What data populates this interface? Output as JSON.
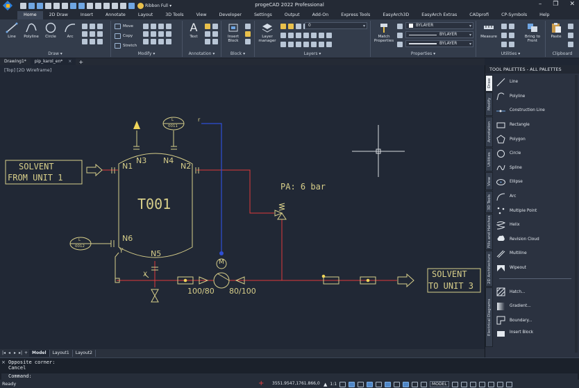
{
  "app": {
    "title": "progeCAD 2022 Professional",
    "ribbon_mode": "Ribbon Full",
    "window_controls": [
      "–",
      "❐",
      "✕"
    ]
  },
  "tabs": [
    "Home",
    "2D Draw",
    "Insert",
    "Annotate",
    "Layout",
    "3D Tools",
    "View",
    "Developer",
    "Settings",
    "Output",
    "Add-On",
    "Express Tools",
    "EasyArch3D",
    "EasyArch Extras",
    "CADprofi",
    "CP-Symbols",
    "Help"
  ],
  "ribbon": {
    "draw": {
      "title": "Draw",
      "tools": [
        "Line",
        "Polyline",
        "Circle",
        "Arc"
      ]
    },
    "modify": {
      "title": "Modify",
      "tools": [
        "Move",
        "Copy",
        "Stretch"
      ]
    },
    "annotation": {
      "title": "Annotation",
      "text": "Text"
    },
    "block": {
      "title": "Block",
      "insert": "Insert Block"
    },
    "layers": {
      "title": "Layers",
      "manager": "Layer manager",
      "current_layer": "0"
    },
    "properties": {
      "title": "Properties",
      "match": "Match Properties",
      "color": "BYLAYER",
      "linetype": "BYLAYER",
      "lineweight": "BYLAYER"
    },
    "utilities": {
      "title": "Utilities",
      "measure": "Measure",
      "bring_to_front": "Bring to Front"
    },
    "clipboard": {
      "title": "Clipboard",
      "paste": "Paste"
    }
  },
  "document_tabs": [
    "Drawing1*",
    "pip_karol_en*"
  ],
  "viewport_label": "[Top] [2D Wireframe]",
  "drawing": {
    "tank_name": "T001",
    "nozzles": [
      "N1",
      "N3",
      "N4",
      "N2",
      "N6",
      "N5"
    ],
    "source_label": [
      "SOLVENT",
      "FROM UNIT 1"
    ],
    "dest_label": [
      "SOLVENT",
      "TO UNIT 3"
    ],
    "pressure_label": "PA: 6 bar",
    "instrument_tags": [
      {
        "letter": "L",
        "number": "0011"
      },
      {
        "letter": "L",
        "number": "0012"
      }
    ],
    "pump_label_left": "100/80",
    "pump_label_right": "80/100",
    "motor_letter": "M",
    "line_marker_r": "r",
    "y_marker": "Y",
    "x_marker": "X"
  },
  "layout_tabs": [
    "Model",
    "Layout1",
    "Layout2"
  ],
  "command_history": [
    "Opposite corner:",
    "Cancel",
    "Command:"
  ],
  "status": {
    "ready": "Ready",
    "coordinates": "3551.9547,1761.866,0",
    "scale": "1:1",
    "space": "MODEL"
  },
  "tool_palette": {
    "header": "TOOL PALETTES - ALL PALETTES",
    "side_tabs": [
      "Draw",
      "Modify",
      "Annotation",
      "Utilities",
      "View",
      "3D Tools",
      "Fills and Hatches",
      "2D Architecture",
      "Electrical Diagrams"
    ],
    "items": [
      "Line",
      "Polyline",
      "Construction Line",
      "Rectangle",
      "Polygon",
      "Circle",
      "Spline",
      "Ellipse",
      "Arc",
      "Multiple Point",
      "Helix",
      "Revision Cloud",
      "Multiline",
      "Wipeout"
    ],
    "items2": [
      "Hatch...",
      "Gradient...",
      "Boundary...",
      "Insert Block"
    ]
  },
  "colors": {
    "canvas": "#212835",
    "process_line": "#e03a3a",
    "equipment": "#d8cf8a",
    "signal_line": "#2f4fd6",
    "accent": "#3b4556"
  }
}
